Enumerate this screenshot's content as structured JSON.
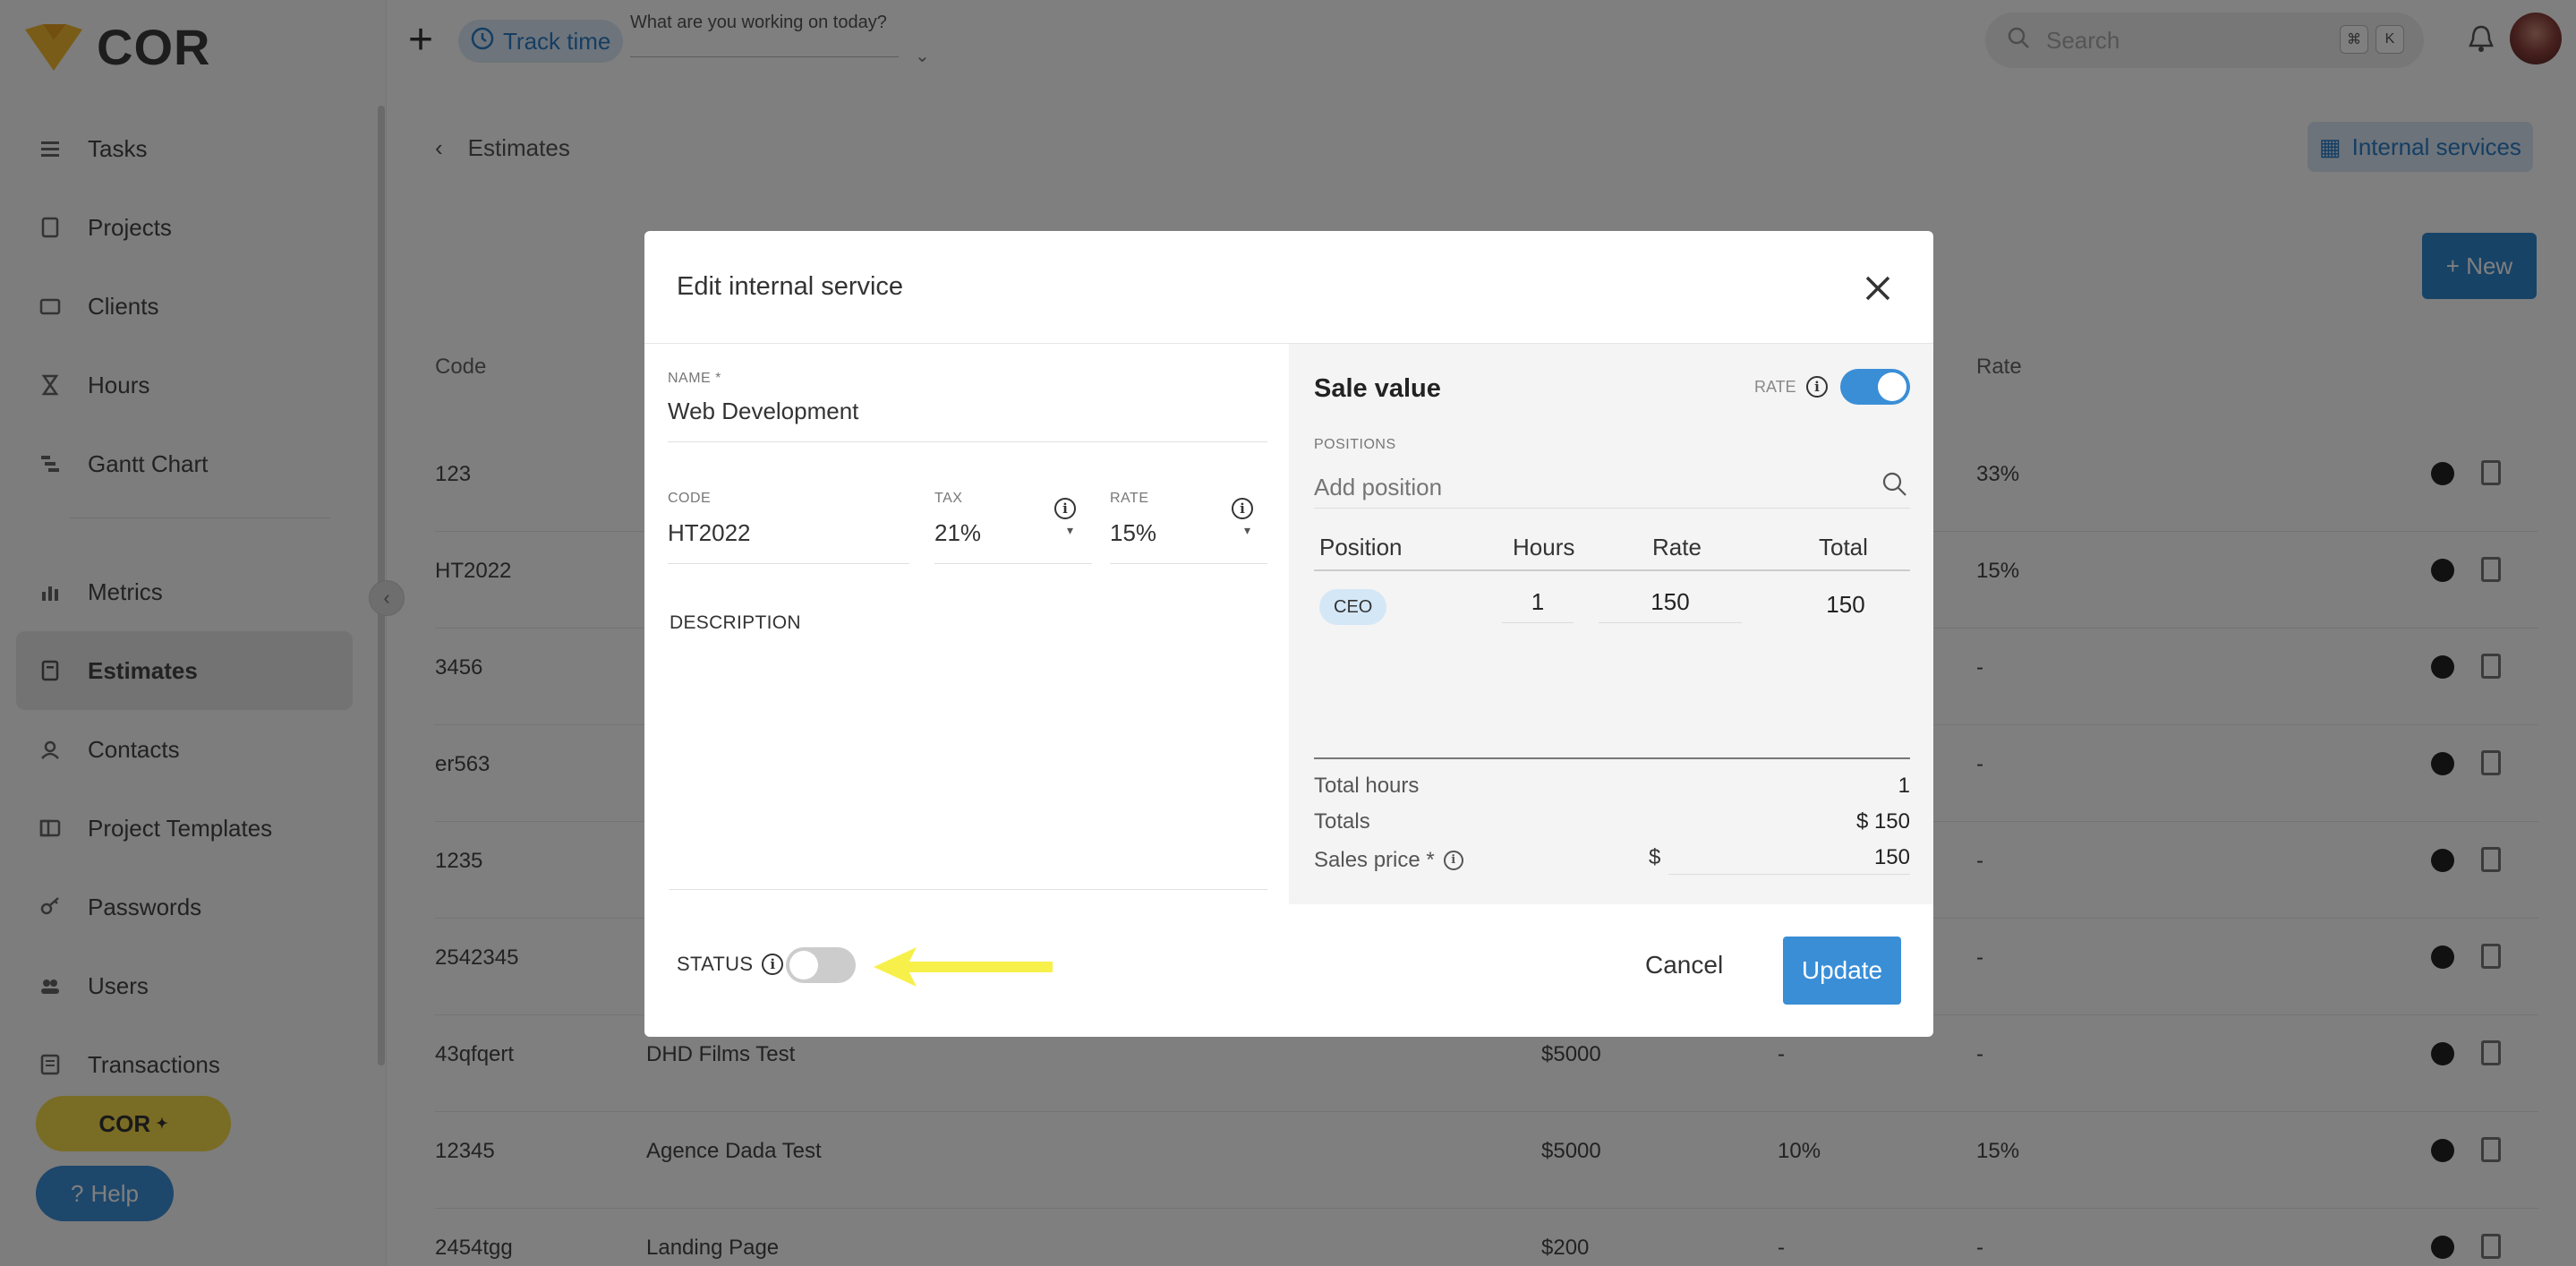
{
  "app": {
    "logo_text": "COR"
  },
  "topbar": {
    "track_label": "Track time",
    "working_placeholder": "What are you working on today?",
    "search_placeholder": "Search",
    "kbd_1": "⌘",
    "kbd_2": "K"
  },
  "sidebar": {
    "items": [
      {
        "label": "Tasks",
        "icon": "tasks-icon"
      },
      {
        "label": "Projects",
        "icon": "projects-icon"
      },
      {
        "label": "Clients",
        "icon": "clients-icon"
      },
      {
        "label": "Hours",
        "icon": "hourglass-icon"
      },
      {
        "label": "Gantt Chart",
        "icon": "gantt-icon"
      },
      {
        "label": "Metrics",
        "icon": "metrics-icon"
      },
      {
        "label": "Estimates",
        "icon": "estimates-icon",
        "active": true
      },
      {
        "label": "Contacts",
        "icon": "contacts-icon"
      },
      {
        "label": "Project Templates",
        "icon": "templates-icon"
      },
      {
        "label": "Passwords",
        "icon": "key-icon"
      },
      {
        "label": "Users",
        "icon": "users-icon"
      },
      {
        "label": "Transactions",
        "icon": "transactions-icon"
      }
    ],
    "cor_pill": "COR",
    "help_label": "Help"
  },
  "page": {
    "breadcrumb": "Estimates",
    "internal_services_label": "Internal services",
    "new_button": "+ New",
    "table_headers": {
      "code": "Code",
      "rate": "Rate"
    },
    "rows": [
      {
        "code": "123",
        "name": "",
        "price": "",
        "tax": "",
        "rate": "33%"
      },
      {
        "code": "HT2022",
        "name": "",
        "price": "",
        "tax": "",
        "rate": "15%"
      },
      {
        "code": "3456",
        "name": "",
        "price": "",
        "tax": "",
        "rate": "-"
      },
      {
        "code": "er563",
        "name": "",
        "price": "",
        "tax": "",
        "rate": "-"
      },
      {
        "code": "1235",
        "name": "",
        "price": "",
        "tax": "",
        "rate": "-"
      },
      {
        "code": "2542345",
        "name": "",
        "price": "",
        "tax": "",
        "rate": "-"
      },
      {
        "code": "43qfqert",
        "name": "DHD Films Test",
        "price": "$5000",
        "tax": "-",
        "rate": "-"
      },
      {
        "code": "12345",
        "name": "Agence Dada Test",
        "price": "$5000",
        "tax": "10%",
        "rate": "15%"
      },
      {
        "code": "2454tgg",
        "name": "Landing Page",
        "price": "$200",
        "tax": "-",
        "rate": "-"
      }
    ]
  },
  "modal": {
    "title": "Edit internal service",
    "name_label": "NAME *",
    "name_value": "Web Development",
    "code_label": "CODE",
    "code_value": "HT2022",
    "tax_label": "TAX",
    "tax_value": "21%",
    "rate_label": "RATE",
    "rate_value": "15%",
    "description_label": "DESCRIPTION",
    "sale_value_title": "Sale value",
    "sale_rate_label": "RATE",
    "positions_label": "POSITIONS",
    "add_position_placeholder": "Add position",
    "table_headers": {
      "position": "Position",
      "hours": "Hours",
      "rate": "Rate",
      "total": "Total"
    },
    "positions": [
      {
        "position": "CEO",
        "hours": "1",
        "rate": "150",
        "total": "150"
      }
    ],
    "total_hours_label": "Total hours",
    "total_hours_value": "1",
    "totals_label": "Totals",
    "totals_value": "$ 150",
    "sales_price_label": "Sales price *",
    "sales_price_currency": "$",
    "sales_price_value": "150",
    "status_label": "STATUS",
    "status_on": false,
    "rate_toggle_on": true,
    "cancel_label": "Cancel",
    "update_label": "Update"
  },
  "colors": {
    "accent": "#3a8ed6",
    "highlight_arrow": "#f7f04a",
    "overlay": "rgba(0,0,0,0.5)"
  }
}
